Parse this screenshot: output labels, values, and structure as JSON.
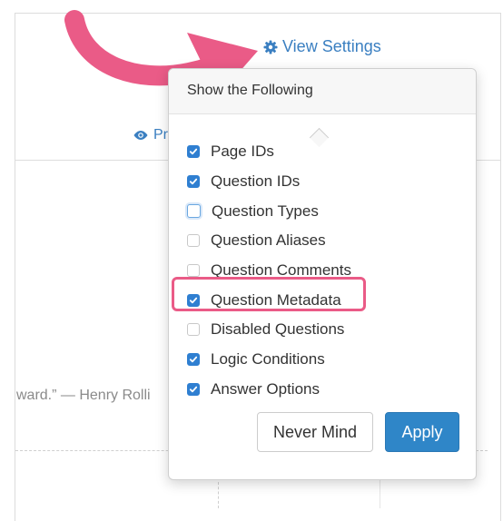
{
  "toolbar": {
    "view_settings_label": "View Settings",
    "preview_label": "Pr"
  },
  "popover": {
    "header": "Show the Following",
    "options": [
      {
        "label": "Page IDs",
        "checked": true
      },
      {
        "label": "Question IDs",
        "checked": true
      },
      {
        "label": "Question Types",
        "checked": false,
        "focused": true
      },
      {
        "label": "Question Aliases",
        "checked": false
      },
      {
        "label": "Question Comments",
        "checked": false
      },
      {
        "label": "Question Metadata",
        "checked": true,
        "highlighted": true
      },
      {
        "label": "Disabled Questions",
        "checked": false
      },
      {
        "label": "Logic Conditions",
        "checked": true
      },
      {
        "label": "Answer Options",
        "checked": true
      }
    ],
    "never_mind_label": "Never Mind",
    "apply_label": "Apply"
  },
  "background": {
    "quote_text": "ward.” — Henry Rolli"
  },
  "colors": {
    "link": "#3a7fc1",
    "checkbox_checked": "#2f7fd1",
    "apply_button": "#2f86c8",
    "annotation_pink": "#ea5b87"
  },
  "icons": {
    "view_settings": "gear-icon",
    "preview": "eye-icon",
    "checkbox": "checkmark-icon"
  }
}
